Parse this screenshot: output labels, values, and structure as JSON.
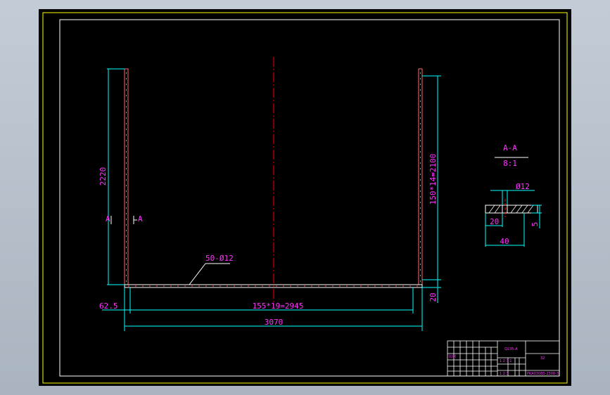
{
  "colors": {
    "frame": "#ffff00",
    "border": "#ffffff",
    "dimension_line": "#00ffff",
    "dimension_text": "#ff33ff",
    "centerline": "#ff0000",
    "plate_edge": "#ff6a6a"
  },
  "drawing": {
    "dimensions": {
      "left_height": "2220",
      "right_height": "150*14=2100",
      "bottom_gap": "20",
      "left_offset": "62.5",
      "hole_spacing": "155*19=2945",
      "overall_width": "3070",
      "hole_callout": "50-Ø12"
    },
    "section_labels": {
      "left": "A",
      "right": "A"
    }
  },
  "section_view": {
    "title": "A-A",
    "scale": "8:1",
    "hole_dia": "Ø12",
    "dim_20": "20",
    "dim_5": "5",
    "dim_40": "40"
  },
  "title_block": {
    "material": "Q235-A",
    "sheet": "32",
    "scale_row": "1  2  3  1",
    "drawing_number": "PKA03080-2300-3",
    "row_a": "比例",
    "row_b": "1  2  3"
  }
}
